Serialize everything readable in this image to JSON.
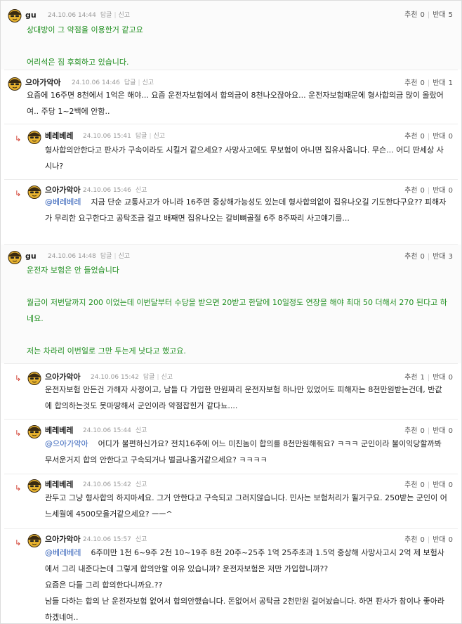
{
  "labels": {
    "reply": "답글",
    "report": "신고",
    "recommend": "추천",
    "oppose": "반대"
  },
  "comments": [
    {
      "nickname": "gu",
      "date": "24.10.06 14:44",
      "recommend": "0",
      "oppose": "5",
      "lines": [
        "상대방이 그 약점을 이용한거 같고요",
        "어리석은 짐 후회하고 있습니다."
      ]
    },
    {
      "nickname": "으아가악아",
      "date": "24.10.06 14:46",
      "recommend": "0",
      "oppose": "1",
      "text": "요즘에 16주면 8천에서 1억은 해야... 요즘 운전자보험에서 합의금이 8천나오잖아요... 운전자보험때문에 형사합의금 많이 올랐어여.. 주당 1~2백에 안함.."
    },
    {
      "nickname": "베레베레",
      "date": "24.10.06 15:41",
      "recommend": "0",
      "oppose": "0",
      "text": "형사합의안한다고 판사가 구속이라도 시킬거 같으세요? 사망사고에도 무보험이 아니면 집유사옵니다. 무슨... 어디 딴세상 사시나?"
    },
    {
      "nickname": "으아가악아",
      "date": "24.10.06 15:46",
      "recommend": "0",
      "oppose": "0",
      "mention": "@베레베레",
      "text": "지금 단순 교통사고가 아니라 16주면 중상해가능성도 있는데 형사합의없이 집유나오길 기도한다구요?? 피해자가 무리한 요구한다고 공탁조금 걸고 배째면 집유나오는 갈비뼈골절 6주 8주짜리 사고얘기를..."
    },
    {
      "nickname": "gu",
      "date": "24.10.06 14:48",
      "recommend": "0",
      "oppose": "3",
      "lines": [
        "운전자 보험은 안 들었습니다",
        "월급이 저번달까지 200 이었는데 이번달부터 수당을 받으면 20받고 한달에 10일정도 연장을 해야 최대 50 더해서 270 된다고 하네요.",
        "저는 차라리 이번일로 그만 두는게 낫다고 했고요."
      ]
    },
    {
      "nickname": "으아가악아",
      "date": "24.10.06 15:42",
      "recommend": "1",
      "oppose": "0",
      "text": "운전자보험 안든건 가해자 사정이고, 남들 다 가입한 만원짜리 운전자보험 하나만 있었어도 피해자는 8천만원받는건데, 반값에 합의하는것도 못마땅해서 군인이라 약점잡힌거 같다뇨...."
    },
    {
      "nickname": "베레베레",
      "date": "24.10.06 15:44",
      "recommend": "0",
      "oppose": "0",
      "mention": "@으아가악아",
      "text": "어디가 불편하신가요? 전치16주에 어느 미친놈이 합의를 8천만원해줘요? ㅋㅋㅋ 군인이라 불이익당할까봐 무서운거지 합의 안한다고 구속되거나 벌금나올거같으세요? ㅋㅋㅋㅋ"
    },
    {
      "nickname": "베레베레",
      "date": "24.10.06 15:42",
      "recommend": "0",
      "oppose": "0",
      "text": "관두고 그냥 형사합의 하지마세요. 그거 안한다고 구속되고 그러지않습니다. 민사는 보험처리가 될거구요. 250받는 군인이 어느세월에 4500모을거같으세요? ㅡㅡ^"
    },
    {
      "nickname": "으아가악아",
      "date": "24.10.06 15:57",
      "recommend": "0",
      "oppose": "0",
      "mention": "@베레베레",
      "text": "6주미만 1천 6~9주 2천 10~19주 8천 20주~25주 1억 25주초과 1.5억 중상해 사망사고시 2억 제 보험사에서 그리 내준다는데 그렇게 합의안할 이유 있습니까? 운전자보험은 저만 가입합니까??",
      "lines": [
        "요즘은 다들 그리 합의한다니까요.??",
        "남들 다하는 합의 난 운전자보험 없어서 합의안했습니다. 돈없어서 공탁금 2천만원 걸어놨습니다. 하면 판사가 참이나 좋아라 하겠네여.."
      ]
    }
  ]
}
